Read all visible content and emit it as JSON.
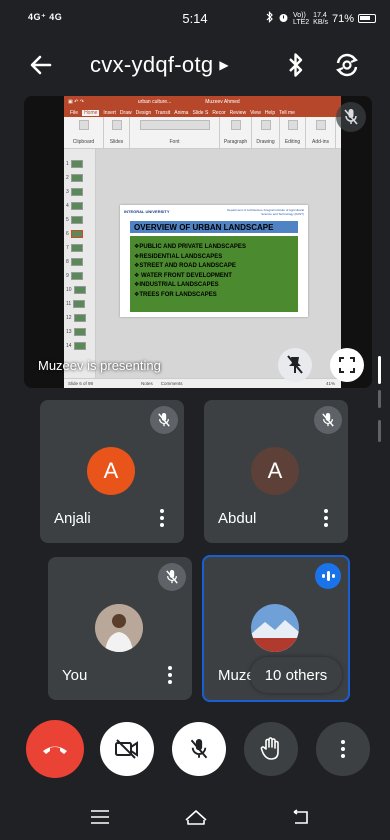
{
  "status_bar": {
    "left_indicators": "4G⁺ 4G",
    "time": "5:14",
    "speed_top": "17.4",
    "speed_bottom": "KB/s",
    "volte_top": "Vo))",
    "volte_bottom": "LTE2",
    "battery_percent": "71%"
  },
  "top_bar": {
    "meeting_code": "cvx-ydqf-otg",
    "icons": [
      "arrow-back-icon",
      "caret-right-icon",
      "bluetooth-icon",
      "switch-camera-icon"
    ]
  },
  "presentation": {
    "presenter_label": "Muzeev is presenting",
    "ppt": {
      "title_text": "urban culture...",
      "user_text": "Muzeev Ahmed",
      "tabs": [
        "File",
        "Home",
        "Insert",
        "Draw",
        "Design",
        "Transit",
        "Anima",
        "Slide S",
        "Recor",
        "Review",
        "View",
        "Help",
        "Tell me"
      ],
      "ribbon_groups": [
        "Clipboard",
        "Slides",
        "Font",
        "Paragraph",
        "Drawing",
        "Editing",
        "Add-ins"
      ],
      "slide_numbers": [
        "1",
        "2",
        "3",
        "4",
        "5",
        "6",
        "7",
        "8",
        "9",
        "10",
        "11",
        "12",
        "13",
        "14"
      ],
      "slide": {
        "logo": "INTEGRAL UNIVERSITY",
        "dept": "Department of Architecture Integral Institute of Agricultural Science and Technology (IIAST)",
        "heading": "OVERVIEW OF URBAN LANDSCAPE",
        "bullets": [
          "❖PUBLIC AND PRIVATE LANDSCAPES",
          "❖RESIDENTIAL LANDSCAPES",
          "❖STREET AND ROAD LANDSCAPE",
          "❖ WATER FRONT DEVELOPMENT",
          "❖INDUSTRIAL LANDSCAPES",
          "❖TREES FOR LANDSCAPES"
        ]
      },
      "status_text": "Slide 6 of 98",
      "notes_label": "Notes",
      "comments_label": "Comments",
      "zoom": "41%"
    }
  },
  "tiles": [
    {
      "name": "Anjali",
      "initial": "A",
      "avatar_color": "#e8541a"
    },
    {
      "name": "Abdul",
      "initial": "A",
      "avatar_color": "#5d4037"
    },
    {
      "name": "You"
    },
    {
      "name": "Muzeev"
    }
  ],
  "others_chip": "10 others",
  "controls": [
    "end-call-icon",
    "camera-off-icon",
    "mic-off-icon",
    "raise-hand-icon",
    "more-vert-icon"
  ],
  "colors": {
    "background": "#202124",
    "tile": "#3c4043",
    "end_call": "#ea4335",
    "accent_blue": "#1a73e8"
  }
}
